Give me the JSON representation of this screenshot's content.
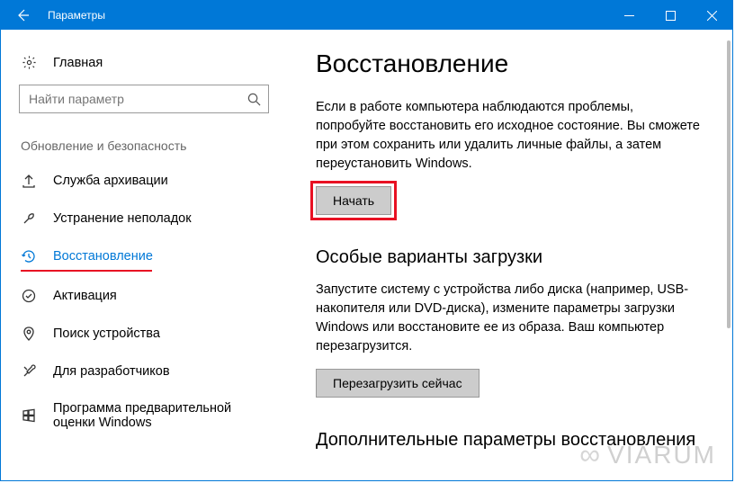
{
  "titlebar": {
    "title": "Параметры"
  },
  "sidebar": {
    "home": "Главная",
    "search_placeholder": "Найти параметр",
    "section": "Обновление и безопасность",
    "items": [
      {
        "label": "Служба архивации"
      },
      {
        "label": "Устранение неполадок"
      },
      {
        "label": "Восстановление"
      },
      {
        "label": "Активация"
      },
      {
        "label": "Поиск устройства"
      },
      {
        "label": "Для разработчиков"
      },
      {
        "label": "Программа предварительной оценки Windows"
      }
    ]
  },
  "main": {
    "title": "Восстановление",
    "section1": {
      "desc": "Если в работе компьютера наблюдаются проблемы, попробуйте восстановить его исходное состояние. Вы сможете при этом сохранить или удалить личные файлы, а затем переустановить Windows.",
      "button": "Начать"
    },
    "section2": {
      "title": "Особые варианты загрузки",
      "desc": "Запустите систему с устройства либо диска (например, USB-накопителя или DVD-диска), измените параметры загрузки Windows или восстановите ее из образа. Ваш компьютер перезагрузится.",
      "button": "Перезагрузить сейчас"
    },
    "section3": {
      "title": "Дополнительные параметры восстановления"
    }
  },
  "watermark": "VIARUM"
}
